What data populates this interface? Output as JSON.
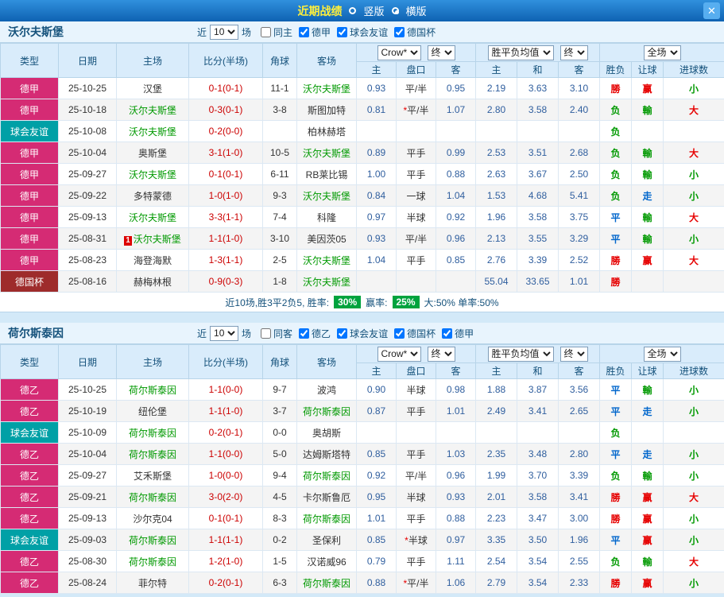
{
  "titlebar": {
    "title": "近期战绩",
    "radios": {
      "vertical": "竖版",
      "horizontal": "横版"
    },
    "close": "✕"
  },
  "controls": {
    "near": "近",
    "count": "10",
    "matches": "场",
    "company": "Crow*",
    "final1": "终",
    "avg": "胜平负均值",
    "final2": "终",
    "scope": "全场"
  },
  "columns": {
    "type": "类型",
    "date": "日期",
    "home": "主场",
    "score": "比分(半场)",
    "corner": "角球",
    "away": "客场",
    "asia_home": "主",
    "asia_handicap": "盘口",
    "asia_away": "客",
    "eu_home": "主",
    "eu_draw": "和",
    "eu_away": "客",
    "result": "胜负",
    "handicap": "让球",
    "goals": "进球数"
  },
  "colors": {
    "focal_team": "#009900",
    "score": "#cc0000",
    "odds": "#2f5e9e",
    "star": "#e60000",
    "badge_green": "#00a33e",
    "red_card_badge": "#dd0000"
  },
  "league_colors": {
    "德甲": "#d52b74",
    "德乙": "#d52b74",
    "球会友谊": "#00a0a6",
    "德国杯": "#9e2b2b"
  },
  "value_colors": {
    "勝": "#e60000",
    "负": "#009900",
    "平": "#0066cc",
    "赢": "#e60000",
    "輸": "#009900",
    "走": "#0066cc",
    "大": "#e60000",
    "小": "#009900"
  },
  "sections": [
    {
      "team": "沃尔夫斯堡",
      "filters": [
        {
          "label": "同主",
          "checked": false
        },
        {
          "label": "德甲",
          "checked": true
        },
        {
          "label": "球会友谊",
          "checked": true
        },
        {
          "label": "德国杯",
          "checked": true
        }
      ],
      "rows": [
        {
          "league": "德甲",
          "date": "25-10-25",
          "home": "汉堡",
          "home_focal": false,
          "score": "0-1(0-1)",
          "corner": "11-1",
          "away": "沃尔夫斯堡",
          "away_focal": true,
          "asia_home": "0.93",
          "asia_handicap": "平/半",
          "asia_away": "0.95",
          "eu_home": "2.19",
          "eu_draw": "3.63",
          "eu_away": "3.10",
          "result": "勝",
          "handicap_result": "赢",
          "goals_result": "小"
        },
        {
          "league": "德甲",
          "date": "25-10-18",
          "home": "沃尔夫斯堡",
          "home_focal": true,
          "score": "0-3(0-1)",
          "corner": "3-8",
          "away": "斯图加特",
          "away_focal": false,
          "asia_home": "0.81",
          "asia_handicap": "*平/半",
          "asia_away": "1.07",
          "eu_home": "2.80",
          "eu_draw": "3.58",
          "eu_away": "2.40",
          "result": "负",
          "handicap_result": "輸",
          "goals_result": "大"
        },
        {
          "league": "球会友谊",
          "date": "25-10-08",
          "home": "沃尔夫斯堡",
          "home_focal": true,
          "score": "0-2(0-0)",
          "corner": "",
          "away": "柏林赫塔",
          "away_focal": false,
          "asia_home": "",
          "asia_handicap": "",
          "asia_away": "",
          "eu_home": "",
          "eu_draw": "",
          "eu_away": "",
          "result": "负",
          "handicap_result": "",
          "goals_result": ""
        },
        {
          "league": "德甲",
          "date": "25-10-04",
          "home": "奥斯堡",
          "home_focal": false,
          "score": "3-1(1-0)",
          "corner": "10-5",
          "away": "沃尔夫斯堡",
          "away_focal": true,
          "asia_home": "0.89",
          "asia_handicap": "平手",
          "asia_away": "0.99",
          "eu_home": "2.53",
          "eu_draw": "3.51",
          "eu_away": "2.68",
          "result": "负",
          "handicap_result": "輸",
          "goals_result": "大"
        },
        {
          "league": "德甲",
          "date": "25-09-27",
          "home": "沃尔夫斯堡",
          "home_focal": true,
          "score": "0-1(0-1)",
          "corner": "6-11",
          "away": "RB莱比锡",
          "away_focal": false,
          "asia_home": "1.00",
          "asia_handicap": "平手",
          "asia_away": "0.88",
          "eu_home": "2.63",
          "eu_draw": "3.67",
          "eu_away": "2.50",
          "result": "负",
          "handicap_result": "輸",
          "goals_result": "小"
        },
        {
          "league": "德甲",
          "date": "25-09-22",
          "home": "多特蒙德",
          "home_focal": false,
          "score": "1-0(1-0)",
          "corner": "9-3",
          "away": "沃尔夫斯堡",
          "away_focal": true,
          "asia_home": "0.84",
          "asia_handicap": "一球",
          "asia_away": "1.04",
          "eu_home": "1.53",
          "eu_draw": "4.68",
          "eu_away": "5.41",
          "result": "负",
          "handicap_result": "走",
          "goals_result": "小"
        },
        {
          "league": "德甲",
          "date": "25-09-13",
          "home": "沃尔夫斯堡",
          "home_focal": true,
          "score": "3-3(1-1)",
          "corner": "7-4",
          "away": "科隆",
          "away_focal": false,
          "asia_home": "0.97",
          "asia_handicap": "半球",
          "asia_away": "0.92",
          "eu_home": "1.96",
          "eu_draw": "3.58",
          "eu_away": "3.75",
          "result": "平",
          "handicap_result": "輸",
          "goals_result": "大"
        },
        {
          "league": "德甲",
          "date": "25-08-31",
          "home": "沃尔夫斯堡",
          "home_focal": true,
          "home_badge": "1",
          "score": "1-1(1-0)",
          "corner": "3-10",
          "away": "美因茨05",
          "away_focal": false,
          "asia_home": "0.93",
          "asia_handicap": "平/半",
          "asia_away": "0.96",
          "eu_home": "2.13",
          "eu_draw": "3.55",
          "eu_away": "3.29",
          "result": "平",
          "handicap_result": "輸",
          "goals_result": "小"
        },
        {
          "league": "德甲",
          "date": "25-08-23",
          "home": "海登海默",
          "home_focal": false,
          "score": "1-3(1-1)",
          "corner": "2-5",
          "away": "沃尔夫斯堡",
          "away_focal": true,
          "asia_home": "1.04",
          "asia_handicap": "平手",
          "asia_away": "0.85",
          "eu_home": "2.76",
          "eu_draw": "3.39",
          "eu_away": "2.52",
          "result": "勝",
          "handicap_result": "赢",
          "goals_result": "大"
        },
        {
          "league": "德国杯",
          "date": "25-08-16",
          "home": "赫梅林根",
          "home_focal": false,
          "score": "0-9(0-3)",
          "corner": "1-8",
          "away": "沃尔夫斯堡",
          "away_focal": true,
          "asia_home": "",
          "asia_handicap": "",
          "asia_away": "",
          "eu_home": "55.04",
          "eu_draw": "33.65",
          "eu_away": "1.01",
          "result": "勝",
          "handicap_result": "",
          "goals_result": ""
        }
      ],
      "summary": {
        "record": "近10场,胜3平2负5, 胜率:",
        "win_rate": "30%",
        "label2": "赢率:",
        "asia_rate": "25%",
        "rest": "大:50% 单率:50%"
      }
    },
    {
      "team": "荷尔斯泰因",
      "filters": [
        {
          "label": "同客",
          "checked": false
        },
        {
          "label": "德乙",
          "checked": true
        },
        {
          "label": "球会友谊",
          "checked": true
        },
        {
          "label": "德国杯",
          "checked": true
        },
        {
          "label": "德甲",
          "checked": true
        }
      ],
      "rows": [
        {
          "league": "德乙",
          "date": "25-10-25",
          "home": "荷尔斯泰因",
          "home_focal": true,
          "score": "1-1(0-0)",
          "corner": "9-7",
          "away": "波鸿",
          "away_focal": false,
          "asia_home": "0.90",
          "asia_handicap": "半球",
          "asia_away": "0.98",
          "eu_home": "1.88",
          "eu_draw": "3.87",
          "eu_away": "3.56",
          "result": "平",
          "handicap_result": "輸",
          "goals_result": "小"
        },
        {
          "league": "德乙",
          "date": "25-10-19",
          "home": "纽伦堡",
          "home_focal": false,
          "score": "1-1(1-0)",
          "corner": "3-7",
          "away": "荷尔斯泰因",
          "away_focal": true,
          "asia_home": "0.87",
          "asia_handicap": "平手",
          "asia_away": "1.01",
          "eu_home": "2.49",
          "eu_draw": "3.41",
          "eu_away": "2.65",
          "result": "平",
          "handicap_result": "走",
          "goals_result": "小"
        },
        {
          "league": "球会友谊",
          "date": "25-10-09",
          "home": "荷尔斯泰因",
          "home_focal": true,
          "score": "0-2(0-1)",
          "corner": "0-0",
          "away": "奥胡斯",
          "away_focal": false,
          "asia_home": "",
          "asia_handicap": "",
          "asia_away": "",
          "eu_home": "",
          "eu_draw": "",
          "eu_away": "",
          "result": "负",
          "handicap_result": "",
          "goals_result": ""
        },
        {
          "league": "德乙",
          "date": "25-10-04",
          "home": "荷尔斯泰因",
          "home_focal": true,
          "score": "1-1(0-0)",
          "corner": "5-0",
          "away": "达姆斯塔特",
          "away_focal": false,
          "asia_home": "0.85",
          "asia_handicap": "平手",
          "asia_away": "1.03",
          "eu_home": "2.35",
          "eu_draw": "3.48",
          "eu_away": "2.80",
          "result": "平",
          "handicap_result": "走",
          "goals_result": "小"
        },
        {
          "league": "德乙",
          "date": "25-09-27",
          "home": "艾禾斯堡",
          "home_focal": false,
          "score": "1-0(0-0)",
          "corner": "9-4",
          "away": "荷尔斯泰因",
          "away_focal": true,
          "asia_home": "0.92",
          "asia_handicap": "平/半",
          "asia_away": "0.96",
          "eu_home": "1.99",
          "eu_draw": "3.70",
          "eu_away": "3.39",
          "result": "负",
          "handicap_result": "輸",
          "goals_result": "小"
        },
        {
          "league": "德乙",
          "date": "25-09-21",
          "home": "荷尔斯泰因",
          "home_focal": true,
          "score": "3-0(2-0)",
          "corner": "4-5",
          "away": "卡尔斯鲁厄",
          "away_focal": false,
          "asia_home": "0.95",
          "asia_handicap": "半球",
          "asia_away": "0.93",
          "eu_home": "2.01",
          "eu_draw": "3.58",
          "eu_away": "3.41",
          "result": "勝",
          "handicap_result": "赢",
          "goals_result": "大"
        },
        {
          "league": "德乙",
          "date": "25-09-13",
          "home": "沙尔克04",
          "home_focal": false,
          "score": "0-1(0-1)",
          "corner": "8-3",
          "away": "荷尔斯泰因",
          "away_focal": true,
          "asia_home": "1.01",
          "asia_handicap": "平手",
          "asia_away": "0.88",
          "eu_home": "2.23",
          "eu_draw": "3.47",
          "eu_away": "3.00",
          "result": "勝",
          "handicap_result": "赢",
          "goals_result": "小"
        },
        {
          "league": "球会友谊",
          "date": "25-09-03",
          "home": "荷尔斯泰因",
          "home_focal": true,
          "score": "1-1(1-1)",
          "corner": "0-2",
          "away": "圣保利",
          "away_focal": false,
          "asia_home": "0.85",
          "asia_handicap": "*半球",
          "asia_away": "0.97",
          "eu_home": "3.35",
          "eu_draw": "3.50",
          "eu_away": "1.96",
          "result": "平",
          "handicap_result": "赢",
          "goals_result": "小"
        },
        {
          "league": "德乙",
          "date": "25-08-30",
          "home": "荷尔斯泰因",
          "home_focal": true,
          "score": "1-2(1-0)",
          "corner": "1-5",
          "away": "汉诺威96",
          "away_focal": false,
          "asia_home": "0.79",
          "asia_handicap": "平手",
          "asia_away": "1.11",
          "eu_home": "2.54",
          "eu_draw": "3.54",
          "eu_away": "2.55",
          "result": "负",
          "handicap_result": "輸",
          "goals_result": "大"
        },
        {
          "league": "德乙",
          "date": "25-08-24",
          "home": "菲尔特",
          "home_focal": false,
          "score": "0-2(0-1)",
          "corner": "6-3",
          "away": "荷尔斯泰因",
          "away_focal": true,
          "asia_home": "0.88",
          "asia_handicap": "*平/半",
          "asia_away": "1.06",
          "eu_home": "2.79",
          "eu_draw": "3.54",
          "eu_away": "2.33",
          "result": "勝",
          "handicap_result": "赢",
          "goals_result": "小"
        }
      ]
    }
  ]
}
